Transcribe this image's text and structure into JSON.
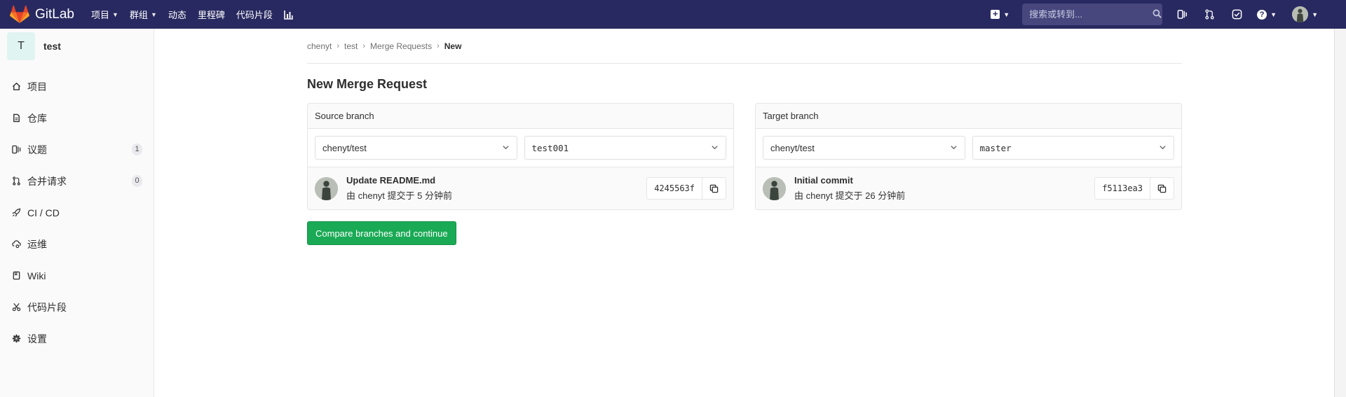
{
  "navbar": {
    "brand": "GitLab",
    "menu": [
      {
        "label": "项目",
        "caret": true
      },
      {
        "label": "群组",
        "caret": true
      },
      {
        "label": "动态",
        "caret": false
      },
      {
        "label": "里程碑",
        "caret": false
      },
      {
        "label": "代码片段",
        "caret": false
      }
    ],
    "search_placeholder": "搜索或转到...",
    "colors": {
      "navbar_bg": "#292961",
      "search_bg": "#47477e"
    }
  },
  "sidebar": {
    "project_initial": "T",
    "project_name": "test",
    "items": [
      {
        "label": "项目",
        "icon": "home-icon"
      },
      {
        "label": "仓库",
        "icon": "document-icon"
      },
      {
        "label": "议题",
        "icon": "issues-icon",
        "badge": "1"
      },
      {
        "label": "合并请求",
        "icon": "merge-request-icon",
        "badge": "0"
      },
      {
        "label": "CI / CD",
        "icon": "rocket-icon"
      },
      {
        "label": "运维",
        "icon": "cloud-gear-icon"
      },
      {
        "label": "Wiki",
        "icon": "book-icon"
      },
      {
        "label": "代码片段",
        "icon": "scissors-icon"
      },
      {
        "label": "设置",
        "icon": "gear-icon"
      }
    ]
  },
  "breadcrumb": {
    "items": [
      "chenyt",
      "test",
      "Merge Requests"
    ],
    "current": "New"
  },
  "page_title": "New Merge Request",
  "source": {
    "heading": "Source branch",
    "project": "chenyt/test",
    "branch": "test001",
    "commit": {
      "title": "Update README.md",
      "meta": "由 chenyt 提交于 5 分钟前",
      "sha": "4245563f"
    }
  },
  "target": {
    "heading": "Target branch",
    "project": "chenyt/test",
    "branch": "master",
    "commit": {
      "title": "Initial commit",
      "meta": "由 chenyt 提交于 26 分钟前",
      "sha": "f5113ea3"
    }
  },
  "compare_button": "Compare branches and continue",
  "accent_green": "#1aaa55"
}
